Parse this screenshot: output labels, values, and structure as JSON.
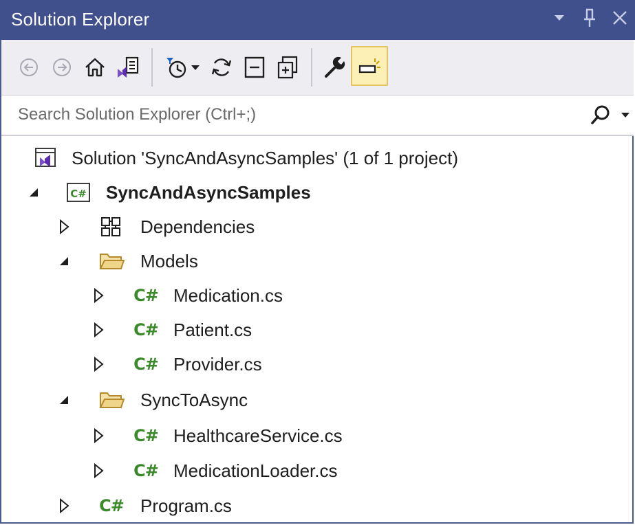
{
  "window": {
    "title": "Solution Explorer"
  },
  "title_actions": [
    {
      "name": "dropdown-icon",
      "glyph": "▼"
    },
    {
      "name": "pin-icon",
      "glyph": "pin"
    },
    {
      "name": "close-icon",
      "glyph": "✕"
    }
  ],
  "toolbar": {
    "items": [
      {
        "name": "back-icon"
      },
      {
        "name": "forward-icon"
      },
      {
        "name": "home-icon"
      },
      {
        "name": "switch-views-icon"
      },
      {
        "name": "pending-changes-filter-icon"
      },
      {
        "name": "sync-icon"
      },
      {
        "name": "collapse-all-icon"
      },
      {
        "name": "show-all-files-icon"
      },
      {
        "name": "properties-icon"
      },
      {
        "name": "preview-selected-items-icon",
        "active": true
      }
    ]
  },
  "search": {
    "placeholder": "Search Solution Explorer (Ctrl+;)"
  },
  "tree": {
    "solution": "Solution 'SyncAndAsyncSamples' (1 of 1 project)",
    "project": "SyncAndAsyncSamples",
    "project_badge": "C#",
    "dependencies": "Dependencies",
    "models_folder": "Models",
    "models_files": [
      "Medication.cs",
      "Patient.cs",
      "Provider.cs"
    ],
    "synctoasync_folder": "SyncToAsync",
    "synctoasync_files": [
      "HealthcareService.cs",
      "MedicationLoader.cs"
    ],
    "program_file": "Program.cs",
    "csharp_file_glyph": "C#"
  },
  "colors": {
    "titlebar": "#40508d",
    "toolbar": "#eeeef2",
    "csharp_green": "#3a8a2a",
    "folder_gold": "#c9a046",
    "active_tool_bg": "#fdf0b6"
  }
}
